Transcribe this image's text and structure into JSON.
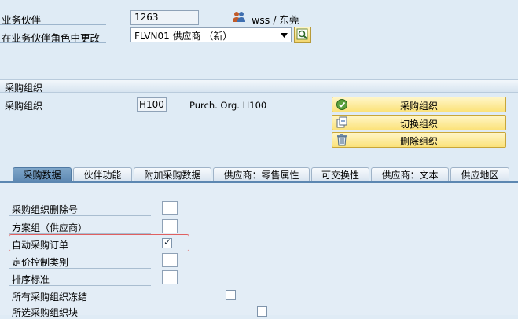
{
  "header": {
    "partner_label": "业务伙伴",
    "partner_value": "1263",
    "user_text": "wss / 东莞",
    "role_label": "在业务伙伴角色中更改",
    "role_value": "FLVN01 供应商 （新）"
  },
  "section": {
    "title": "采购组织",
    "org_label": "采购组织",
    "org_value": "H100",
    "org_desc": "Purch. Org. H100"
  },
  "buttons": {
    "purch_org": "采购组织",
    "switch_org": "切换组织",
    "delete_org": "删除组织"
  },
  "tabs": [
    {
      "label": "采购数据"
    },
    {
      "label": "伙伴功能"
    },
    {
      "label": "附加采购数据"
    },
    {
      "label": "供应商：零售属性"
    },
    {
      "label": "可交换性"
    },
    {
      "label": "供应商：文本"
    },
    {
      "label": "供应地区"
    }
  ],
  "rows": [
    {
      "label": "采购组织删除号",
      "checked": false
    },
    {
      "label": "方案组（供应商）",
      "checked": false
    },
    {
      "label": "自动采购订单",
      "checked": true
    },
    {
      "label": "定价控制类别",
      "checked": false
    },
    {
      "label": "排序标准",
      "checked": false
    },
    {
      "label": "所有采购组织冻结",
      "checked": false
    },
    {
      "label": "所选采购组织块",
      "checked": false
    }
  ],
  "check_mark": "✓",
  "colors": {
    "accent": "#5c87b1",
    "button": "#fbe27a",
    "highlight": "#e06060"
  }
}
